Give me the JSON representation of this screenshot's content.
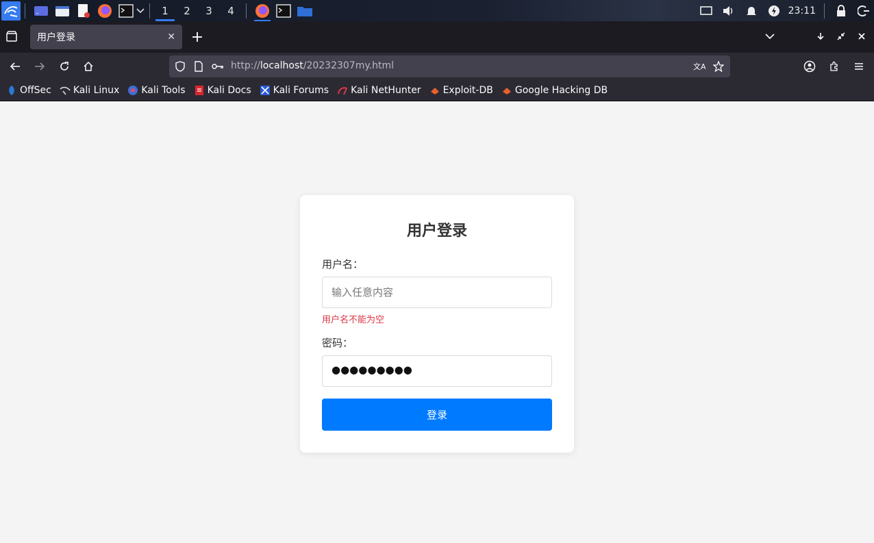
{
  "taskbar": {
    "workspaces": [
      "1",
      "2",
      "3",
      "4"
    ],
    "clock": "23:11"
  },
  "browser": {
    "tab_title": "用户登录",
    "url_prefix": "http://",
    "url_host": "localhost",
    "url_path": "/20232307my.html",
    "bookmarks": [
      "OffSec",
      "Kali Linux",
      "Kali Tools",
      "Kali Docs",
      "Kali Forums",
      "Kali NetHunter",
      "Exploit-DB",
      "Google Hacking DB"
    ]
  },
  "login": {
    "title": "用户登录",
    "username_label": "用户名：",
    "username_placeholder": "输入任意内容",
    "username_error": "用户名不能为空",
    "password_label": "密码：",
    "password_masked": "●●●●●●●●●",
    "submit_label": "登录"
  },
  "colors": {
    "accent": "#007bff",
    "error": "#dc3545",
    "taskbar_accent": "#367bf0"
  }
}
